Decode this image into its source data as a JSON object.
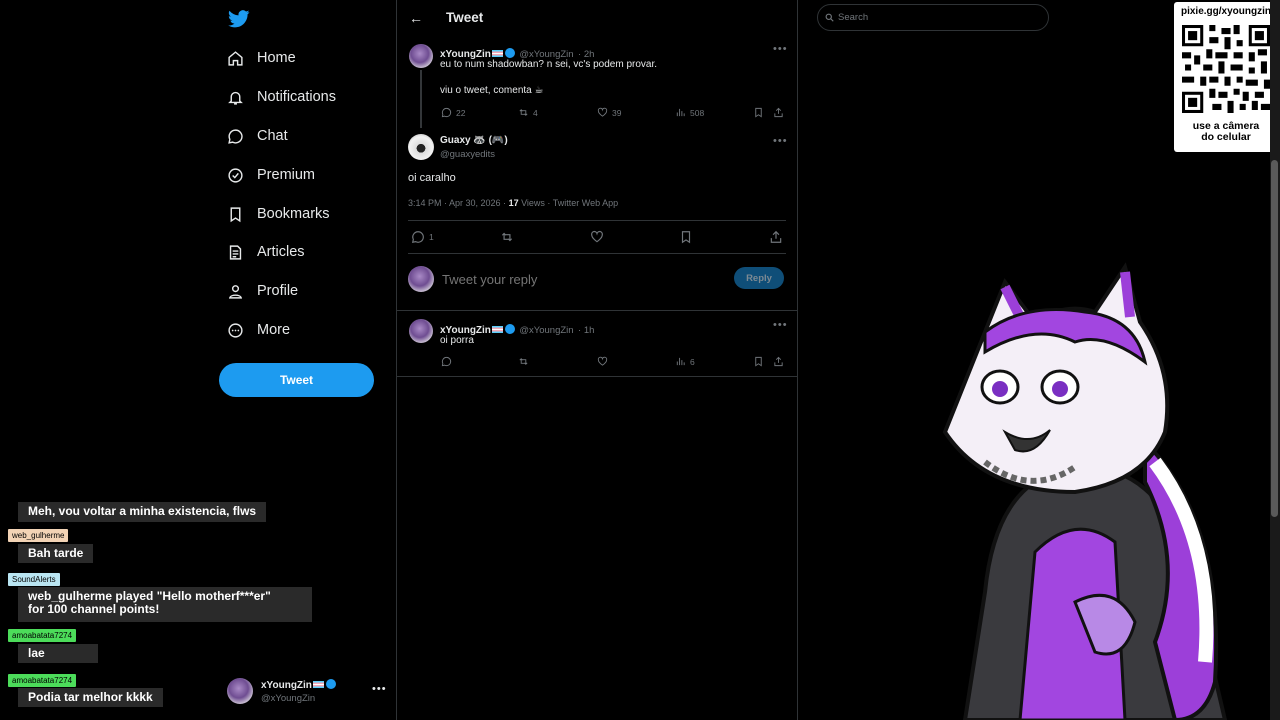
{
  "nav": {
    "items": [
      {
        "label": "Home",
        "icon": "home-icon"
      },
      {
        "label": "Notifications",
        "icon": "bell-icon"
      },
      {
        "label": "Chat",
        "icon": "chat-icon"
      },
      {
        "label": "Premium",
        "icon": "premium-icon"
      },
      {
        "label": "Bookmarks",
        "icon": "bookmark-icon"
      },
      {
        "label": "Articles",
        "icon": "articles-icon"
      },
      {
        "label": "Profile",
        "icon": "profile-icon"
      },
      {
        "label": "More",
        "icon": "more-circle-icon"
      }
    ],
    "tweet_button": "Tweet",
    "account": {
      "name": "xYoungZin",
      "handle": "@xYoungZin"
    }
  },
  "header": {
    "title": "Tweet"
  },
  "parent_tweet": {
    "name": "xYoungZin",
    "handle": "@xYoungZin",
    "time": "· 2h",
    "text1": "eu to num shadowban? n sei, vc's podem provar.",
    "text2": "viu o tweet, comenta ☕",
    "replies": "22",
    "retweets": "4",
    "likes": "39",
    "views": "508"
  },
  "main_tweet": {
    "name": "Guaxy 🦝 (🎮)",
    "handle": "@guaxyedits",
    "text": "oi caralho",
    "meta_prefix": "3:14 PM · Apr 30, 2026 · ",
    "views_count": "17",
    "meta_suffix": " Views · Twitter Web App",
    "replies": "1"
  },
  "reply_box": {
    "placeholder": "Tweet your reply",
    "button": "Reply"
  },
  "reply_tweet": {
    "name": "xYoungZin",
    "handle": "@xYoungZin",
    "time": "· 1h",
    "text": "oi porra",
    "views": "6"
  },
  "search": {
    "placeholder": "Search"
  },
  "qr": {
    "url": "pixie.gg/xyoungzin",
    "caption1": "use a câmera",
    "caption2": "do celular"
  },
  "chat": [
    {
      "user": "",
      "text": "Meh, vou voltar a minha existencia, flws"
    },
    {
      "user": "web_gulherme",
      "text": "Bah tarde"
    },
    {
      "user": "SoundAlerts",
      "text1": "web_gulherme played \"Hello motherf***er\"",
      "text2": "for 100 channel points!"
    },
    {
      "user": "amoabatata7274",
      "text": "lae"
    },
    {
      "user": "amoabatata7274",
      "text": "Podia tar melhor kkkk"
    }
  ],
  "colors": {
    "accent": "#1d9bf0",
    "bg": "#000000",
    "border": "#2f3336",
    "muted": "#71767b"
  }
}
